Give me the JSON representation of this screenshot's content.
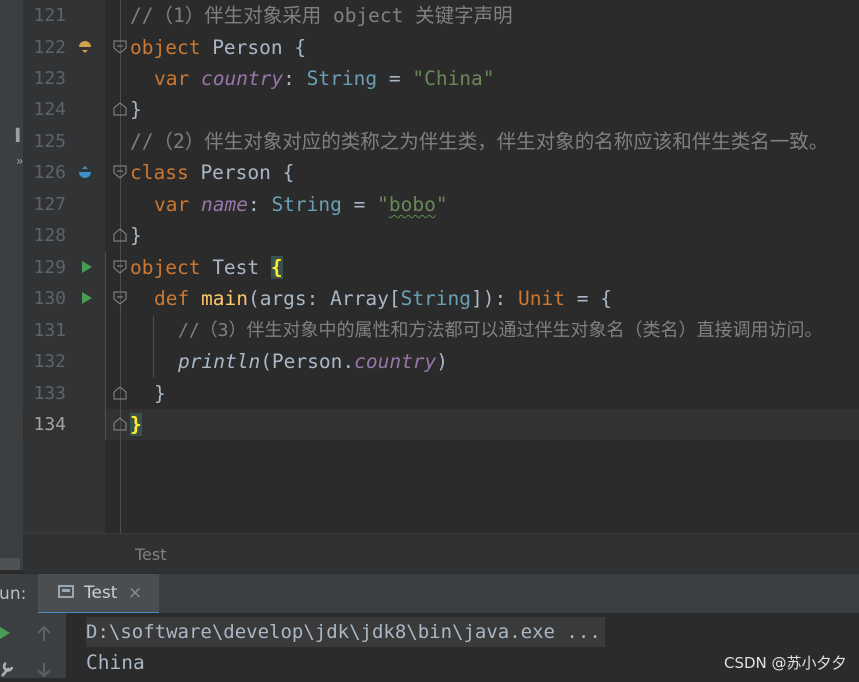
{
  "editor": {
    "line_numbers": [
      "121",
      "122",
      "123",
      "124",
      "125",
      "126",
      "127",
      "128",
      "129",
      "130",
      "131",
      "132",
      "133",
      "134"
    ],
    "active_line": "134",
    "lines": {
      "l121": {
        "comment": "//（1）伴生对象采用 object 关键字声明"
      },
      "l122": {
        "kw": "object",
        "name": " Person {"
      },
      "l123": {
        "kw": "var",
        "prop": "country",
        "colon": ": ",
        "type": "String",
        "eq": " = ",
        "str": "\"China\""
      },
      "l124": {
        "text": "}"
      },
      "l125": {
        "comment": "//（2）伴生对象对应的类称之为伴生类，伴生对象的名称应该和伴生类名一致。"
      },
      "l126": {
        "kw": "class",
        "name": " Person {"
      },
      "l127": {
        "kw": "var",
        "prop": "name",
        "colon": ": ",
        "type": "String",
        "eq": " = ",
        "str_q1": "\"",
        "str_body": "bobo",
        "str_q2": "\""
      },
      "l128": {
        "text": "}"
      },
      "l129": {
        "kw": "object",
        "name": " Test ",
        "brace": "{"
      },
      "l130": {
        "kw": "def",
        "fn": "main",
        "p1": "(args: Array[",
        "type": "String",
        "p2": "]): ",
        "ret": "Unit",
        "p3": " = {"
      },
      "l131": {
        "comment": "//（3）伴生对象中的属性和方法都可以通过伴生对象名（类名）直接调用访问。"
      },
      "l132": {
        "fn": "println",
        "p1": "(Person.",
        "prop": "country",
        "p2": ")"
      },
      "l133": {
        "text": "}"
      },
      "l134": {
        "brace": "}"
      }
    }
  },
  "breadcrumb": {
    "item": "Test"
  },
  "run_panel": {
    "label": "Run:",
    "tab_label": "Test",
    "tab_close": "×",
    "command": "D:\\software\\develop\\jdk\\jdk8\\bin\\java.exe ...",
    "output": "China"
  },
  "watermark": "CSDN @苏小夕夕",
  "colors": {
    "background": "#2b2b2b",
    "keyword": "#cc7832",
    "string": "#6a8759",
    "property": "#9876aa",
    "function": "#ffc66d",
    "comment": "#808080",
    "run_arrow": "#499c54"
  }
}
